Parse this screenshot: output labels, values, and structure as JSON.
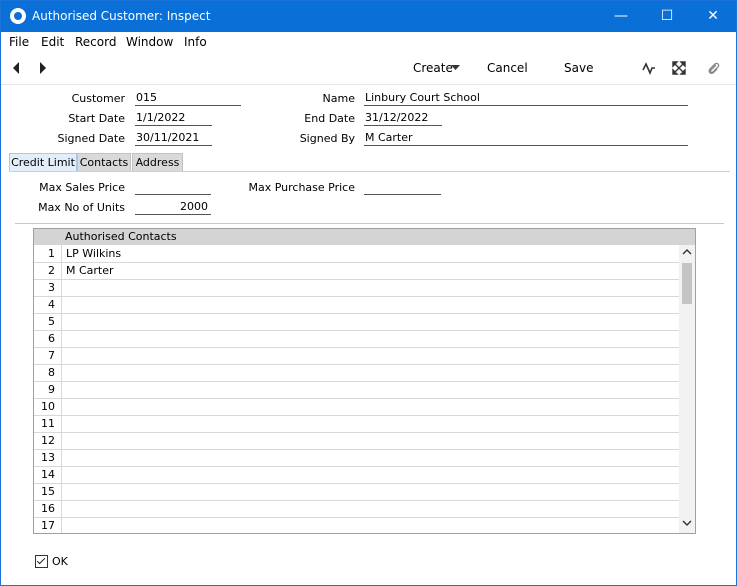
{
  "window": {
    "title": "Authorised Customer: Inspect",
    "minimize_glyph": "—",
    "maximize_glyph": "☐",
    "close_glyph": "✕"
  },
  "menu": [
    "File",
    "Edit",
    "Record",
    "Window",
    "Info"
  ],
  "toolbar": {
    "create_label": "Create",
    "cancel_label": "Cancel",
    "save_label": "Save"
  },
  "header": {
    "customer_label": "Customer",
    "customer_value": "015",
    "name_label": "Name",
    "name_value": "Linbury Court School",
    "start_date_label": "Start Date",
    "start_date_value": "1/1/2022",
    "end_date_label": "End Date",
    "end_date_value": "31/12/2022",
    "signed_date_label": "Signed Date",
    "signed_date_value": "30/11/2021",
    "signed_by_label": "Signed By",
    "signed_by_value": "M Carter"
  },
  "tabs": [
    {
      "label": "Credit Limit",
      "active": true
    },
    {
      "label": "Contacts",
      "active": false
    },
    {
      "label": "Address",
      "active": false
    }
  ],
  "credit_limit": {
    "max_sales_price_label": "Max Sales Price",
    "max_sales_price_value": "",
    "max_purchase_price_label": "Max Purchase Price",
    "max_purchase_price_value": "",
    "max_units_label": "Max No of Units",
    "max_units_value": "2000"
  },
  "grid": {
    "column_header": "Authorised Contacts",
    "rows": [
      {
        "num": "1",
        "value": "LP Wilkins"
      },
      {
        "num": "2",
        "value": "M Carter"
      },
      {
        "num": "3",
        "value": ""
      },
      {
        "num": "4",
        "value": ""
      },
      {
        "num": "5",
        "value": ""
      },
      {
        "num": "6",
        "value": ""
      },
      {
        "num": "7",
        "value": ""
      },
      {
        "num": "8",
        "value": ""
      },
      {
        "num": "9",
        "value": ""
      },
      {
        "num": "10",
        "value": ""
      },
      {
        "num": "11",
        "value": ""
      },
      {
        "num": "12",
        "value": ""
      },
      {
        "num": "13",
        "value": ""
      },
      {
        "num": "14",
        "value": ""
      },
      {
        "num": "15",
        "value": ""
      },
      {
        "num": "16",
        "value": ""
      },
      {
        "num": "17",
        "value": ""
      }
    ]
  },
  "ok": {
    "label": "OK",
    "checked": true
  }
}
